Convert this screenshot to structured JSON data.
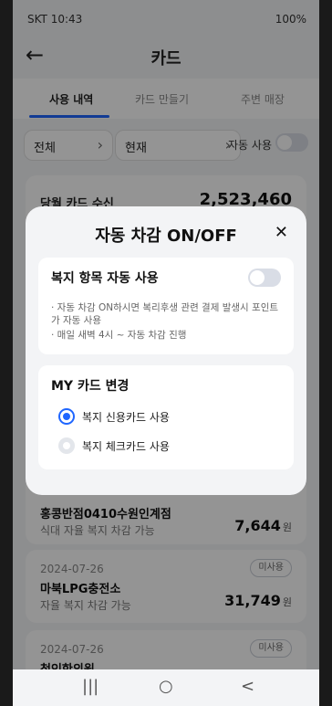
{
  "status": {
    "time": "SKT 10:43",
    "right": "100%"
  },
  "header": {
    "title": "카드"
  },
  "tabs": [
    {
      "label": "사용 내역",
      "active": true
    },
    {
      "label": "카드 만들기",
      "active": false
    },
    {
      "label": "주변 매장",
      "active": false
    }
  ],
  "filters": {
    "period": "전체",
    "state": "현재",
    "auto_use_label": "자동 사용"
  },
  "summary": {
    "label": "당월 카드 수신",
    "amount": "2,523,460"
  },
  "list": [
    {
      "date": "",
      "badge": "",
      "merchant": "홍콩반점0410수원인계점",
      "note": "식대 자율 복지 차감 가능",
      "amount": "7,644",
      "unit": "원"
    },
    {
      "date": "2024-07-26",
      "badge": "미사용",
      "merchant": "마북LPG충전소",
      "note": "자율 복지 차감 가능",
      "amount": "31,749",
      "unit": "원"
    },
    {
      "date": "2024-07-26",
      "badge": "미사용",
      "merchant": "청인한의원",
      "note": "",
      "amount": "",
      "unit": ""
    }
  ],
  "modal": {
    "title": "자동 차감 ON/OFF",
    "close": "✕",
    "welfare": {
      "title": "복지 항목 자동 사용",
      "desc1": "· 자동 차감 ON하시면 복리후생 관련 결제 발생시 포인트가 자동 사용",
      "desc2": "· 매일 새벽 4시 ~ 자동 차감 진행",
      "toggle_on": false
    },
    "my_card": {
      "title": "MY 카드 변경",
      "options": [
        {
          "label": "복지 신용카드 사용",
          "selected": true
        },
        {
          "label": "복지 체크카드 사용",
          "selected": false
        }
      ]
    }
  },
  "navbar": {
    "recent": "|||",
    "home": "○",
    "back": "<"
  }
}
